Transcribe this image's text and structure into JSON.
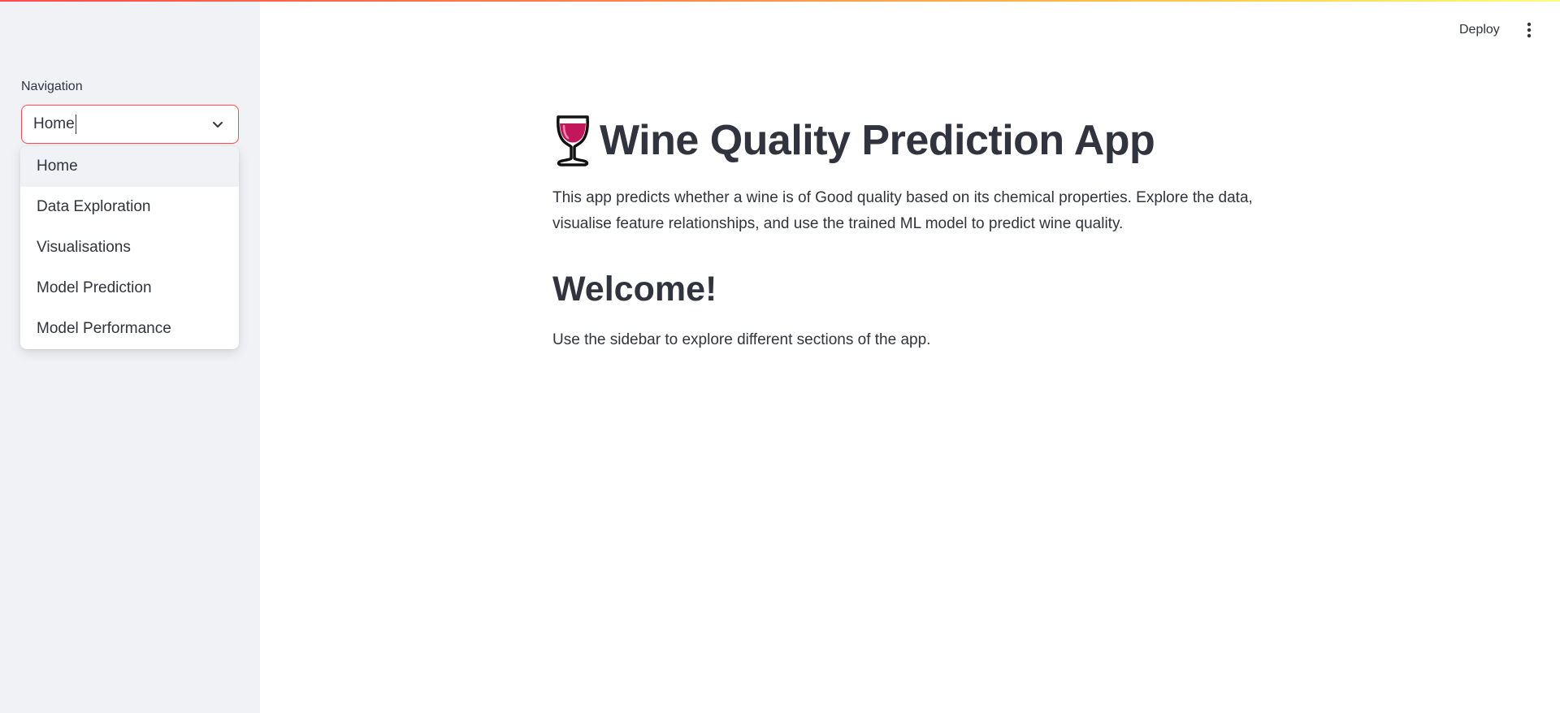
{
  "header": {
    "deploy_label": "Deploy",
    "menu_icon": "kebab-menu-icon"
  },
  "sidebar": {
    "nav_label": "Navigation",
    "select": {
      "value": "Home",
      "chevron_icon": "chevron-down-icon",
      "options": [
        {
          "label": "Home"
        },
        {
          "label": "Data Exploration"
        },
        {
          "label": "Visualisations"
        },
        {
          "label": "Model Prediction"
        },
        {
          "label": "Model Performance"
        }
      ]
    }
  },
  "main": {
    "title_icon": "wine-glass-icon",
    "title": "Wine Quality Prediction App",
    "intro": "This app predicts whether a wine is of Good quality based on its chemical properties. Explore the data, visualise feature relationships, and use the trained ML model to predict wine quality.",
    "welcome_heading": "Welcome!",
    "hint": "Use the sidebar to explore different sections of the app."
  },
  "colors": {
    "accent": "#ff4b4b",
    "sidebar_bg": "#f0f2f6",
    "text": "#31333f",
    "wine": "#c2185b"
  }
}
